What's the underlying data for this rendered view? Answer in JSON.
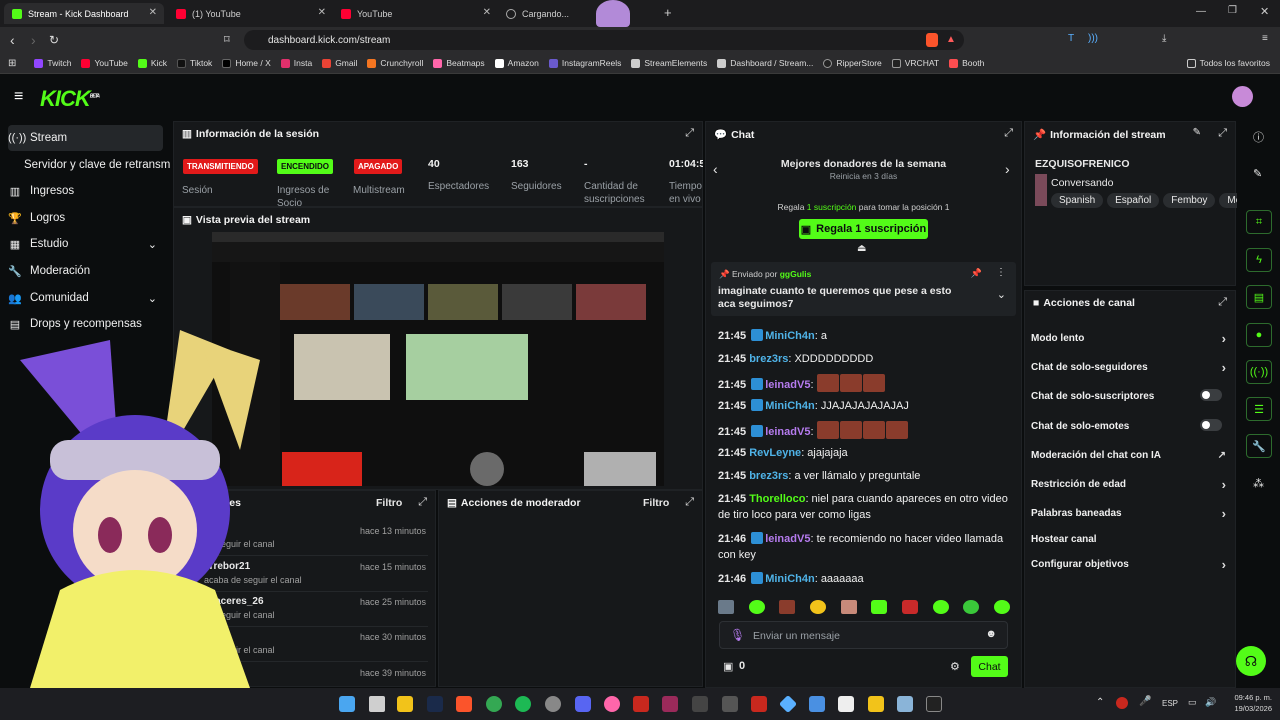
{
  "browser": {
    "tabs": [
      {
        "title": "Stream - Kick Dashboard",
        "active": true
      },
      {
        "title": "(1) YouTube"
      },
      {
        "title": "YouTube"
      },
      {
        "title": "Cargando..."
      }
    ],
    "url": "dashboard.kick.com/stream",
    "bookmarks": [
      "Twitch",
      "YouTube",
      "Kick",
      "Tiktok",
      "Home / X",
      "Insta",
      "Gmail",
      "Crunchyroll",
      "Beatmaps",
      "Amazon",
      "InstagramReels",
      "StreamElements",
      "Dashboard / Stream...",
      "RipperStore",
      "VRCHAT",
      "Booth"
    ],
    "all_favorites": "Todos los favoritos"
  },
  "kick": {
    "logo": "KICK",
    "beta": "BETA"
  },
  "sidebar": {
    "items": [
      {
        "label": "Stream",
        "icon": "broadcast-icon"
      },
      {
        "label": "Servidor y clave de retransm"
      },
      {
        "label": "Ingresos",
        "icon": "chart-icon"
      },
      {
        "label": "Logros",
        "icon": "trophy-icon"
      },
      {
        "label": "Estudio",
        "icon": "grid-icon"
      },
      {
        "label": "Moderación",
        "icon": "wrench-icon"
      },
      {
        "label": "Comunidad",
        "icon": "people-icon"
      },
      {
        "label": "Drops y recompensas",
        "icon": "gift-icon"
      }
    ]
  },
  "session": {
    "title": "Información de la sesión",
    "stats": [
      {
        "badge": "TRANSMITIENDO",
        "label": "Sesión"
      },
      {
        "badge": "ENCENDIDO",
        "label": "Ingresos de Socio"
      },
      {
        "badge": "APAGADO",
        "label": "Multistream"
      },
      {
        "value": "40",
        "label": "Espectadores"
      },
      {
        "value": "163",
        "label": "Seguidores"
      },
      {
        "value": "-",
        "label": "Cantidad de suscripciones"
      },
      {
        "value": "01:04:5",
        "label": "Tiempo en vivo"
      }
    ]
  },
  "preview": {
    "title": "Vista previa del stream"
  },
  "activity": {
    "title": "Actividades",
    "filter": "Filtro",
    "rows": [
      {
        "name": "H2",
        "sub": "de seguir el canal",
        "time": "hace 13 minutos"
      },
      {
        "name": "rTrebor21",
        "sub": "acaba de seguir el canal",
        "time": "hace 15 minutos"
      },
      {
        "name": "scaceres_26",
        "sub": "de seguir el canal",
        "time": "hace 25 minutos"
      },
      {
        "name": "",
        "sub": "de seguir el canal",
        "time": "hace 30 minutos"
      },
      {
        "name": "evenge",
        "sub": "",
        "time": "hace 39 minutos"
      }
    ]
  },
  "mod_actions": {
    "title": "Acciones de moderador",
    "filter": "Filtro"
  },
  "chat": {
    "title": "Chat",
    "donors_title": "Mejores donadores de la semana",
    "donors_reset": "Reinicia en 3 días",
    "gift_prefix": "Regala",
    "gift_sub": "1 suscripción",
    "gift_suffix": "para tomar la posición 1",
    "gift_button": "Regala 1 suscripción",
    "pinned_by_label": "Enviado por",
    "pinned_by": "ggGulis",
    "pinned_text": "imaginate cuanto te queremos que pese a esto aca seguimos7",
    "messages": [
      {
        "time": "21:45",
        "user": "MiniCh4n",
        "color": "#4fb3e8",
        "text": ": a"
      },
      {
        "time": "21:45",
        "user": "brez3rs",
        "color": "#4fb3e8",
        "text": ": XDDDDDDDDD"
      },
      {
        "time": "21:45",
        "user": "leinadV5",
        "color": "#b57bee",
        "text": ":",
        "emotes": 3
      },
      {
        "time": "21:45",
        "user": "MiniCh4n",
        "color": "#4fb3e8",
        "text": ": JJAJAJAJAJAJAJ"
      },
      {
        "time": "21:45",
        "user": "leinadV5",
        "color": "#b57bee",
        "text": ":",
        "emotes": 4
      },
      {
        "time": "21:45",
        "user": "RevLeyne",
        "color": "#4fb3e8",
        "text": ": ajajajaja"
      },
      {
        "time": "21:45",
        "user": "brez3rs",
        "color": "#4fb3e8",
        "text": ": a ver llámalo y preguntale"
      },
      {
        "time": "21:45",
        "user": "Thorelloco",
        "color": "#53fc18",
        "text": ": niel para cuando apareces en otro video de tiro loco para ver como ligas"
      },
      {
        "time": "21:46",
        "user": "leinadV5",
        "color": "#b57bee",
        "text": ": te recomiendo no hacer video llamada con key"
      },
      {
        "time": "21:46",
        "user": "MiniCh4n",
        "color": "#4fb3e8",
        "text": ": aaaaaaa"
      }
    ],
    "input_placeholder": "Enviar un mensaje",
    "points": "0",
    "send_button": "Chat"
  },
  "stream_info": {
    "title": "Información del stream",
    "channel": "EZQUISOFRENICO",
    "category": "Conversando",
    "tags": [
      "Spanish",
      "Español",
      "Femboy",
      "Mé"
    ]
  },
  "channel_actions": {
    "title": "Acciones de canal",
    "items": [
      {
        "label": "Modo lento",
        "type": "chevron"
      },
      {
        "label": "Chat de solo-seguidores",
        "type": "chevron"
      },
      {
        "label": "Chat de solo-suscriptores",
        "type": "toggle"
      },
      {
        "label": "Chat de solo-emotes",
        "type": "toggle"
      },
      {
        "label": "Moderación del chat con IA",
        "type": "external"
      },
      {
        "label": "Restricción de edad",
        "type": "chevron"
      },
      {
        "label": "Palabras baneadas",
        "type": "chevron"
      },
      {
        "label": "Hostear canal",
        "type": "none"
      },
      {
        "label": "Configurar objetivos",
        "type": "chevron"
      }
    ]
  },
  "taskbar": {
    "lang": "ESP",
    "time": "09:46 p. m.",
    "date": "19/03/2026"
  },
  "colors": {
    "accent": "#53fc18",
    "live": "#e21a1a",
    "bg": "#0b0d0e",
    "panel": "#16181a"
  }
}
